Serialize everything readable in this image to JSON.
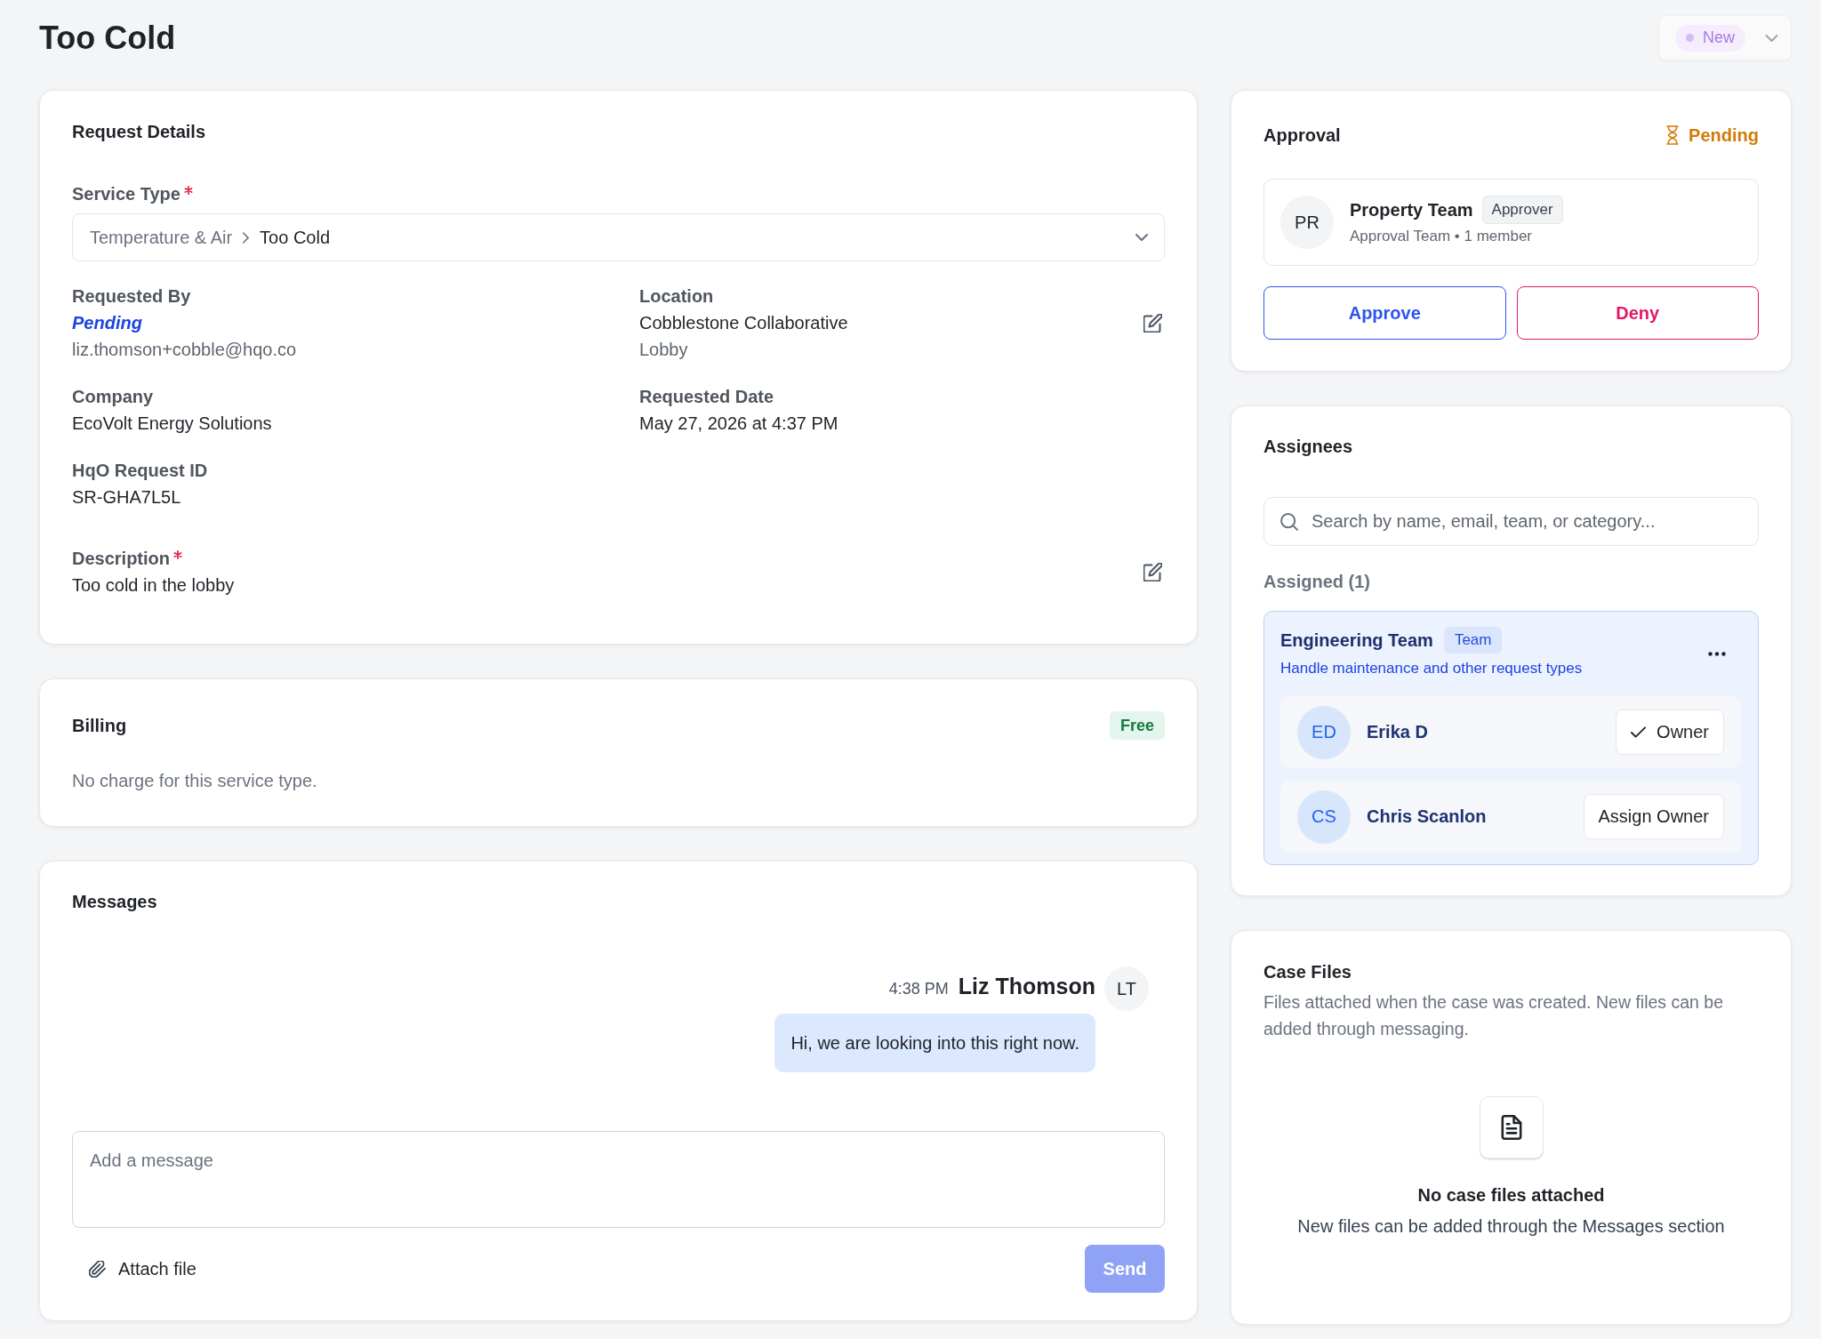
{
  "header": {
    "title": "Too Cold",
    "status": {
      "label": "New",
      "kind": "new"
    }
  },
  "request_details": {
    "title": "Request Details",
    "service_type": {
      "label": "Service Type",
      "required": true,
      "category": "Temperature & Air",
      "value": "Too Cold"
    },
    "fields": [
      {
        "label": "Requested By",
        "editable": false,
        "lines": [
          {
            "text": "Pending",
            "kind": "pending"
          },
          {
            "text": "liz.thomson+cobble@hqo.co",
            "kind": "muted"
          }
        ]
      },
      {
        "label": "Location",
        "editable": true,
        "lines": [
          {
            "text": "Cobblestone Collaborative",
            "kind": "value"
          },
          {
            "text": "Lobby",
            "kind": "muted"
          }
        ]
      },
      {
        "label": "Company",
        "editable": false,
        "lines": [
          {
            "text": "EcoVolt Energy Solutions",
            "kind": "value"
          }
        ]
      },
      {
        "label": "Requested Date",
        "editable": false,
        "lines": [
          {
            "text": "May 27, 2026 at 4:37 PM",
            "kind": "value"
          }
        ]
      },
      {
        "label": "HqO Request ID",
        "editable": false,
        "lines": [
          {
            "text": "SR-GHA7L5L",
            "kind": "value"
          }
        ]
      }
    ],
    "description": {
      "label": "Description",
      "required": true,
      "editable": true,
      "value": "Too cold in the lobby"
    }
  },
  "billing": {
    "title": "Billing",
    "tag": "Free",
    "note": "No charge for this service type."
  },
  "messages": {
    "title": "Messages",
    "items": [
      {
        "time": "4:38 PM",
        "author": "Liz Thomson",
        "initials": "LT",
        "text": "Hi, we are looking into this right now."
      }
    ],
    "composer": {
      "placeholder": "Add a message"
    },
    "attach": "Attach file",
    "send": {
      "label": "Send",
      "disabled": true
    }
  },
  "approval": {
    "title": "Approval",
    "status": {
      "label": "Pending",
      "kind": "pending"
    },
    "approver": {
      "initials": "PR",
      "name": "Property Team",
      "role": "Approver",
      "detail": "Approval Team • 1 member"
    },
    "actions": [
      {
        "label": "Approve",
        "kind": "approve"
      },
      {
        "label": "Deny",
        "kind": "deny"
      }
    ]
  },
  "assignees": {
    "title": "Assignees",
    "search": {
      "placeholder": "Search by name, email, team, or category..."
    },
    "assigned_label": "Assigned (1)",
    "teams": [
      {
        "name": "Engineering Team",
        "tag": "Team",
        "description": "Handle maintenance and other request types",
        "members": [
          {
            "initials": "ED",
            "name": "Erika D",
            "owner": true,
            "action": "Owner"
          },
          {
            "initials": "CS",
            "name": "Chris Scanlon",
            "owner": false,
            "action": "Assign Owner"
          }
        ]
      }
    ]
  },
  "case_files": {
    "title": "Case Files",
    "description": "Files attached when the case was created. New files can be added through messaging.",
    "empty_title": "No case files attached",
    "empty_text": "New files can be added through the Messages section"
  }
}
